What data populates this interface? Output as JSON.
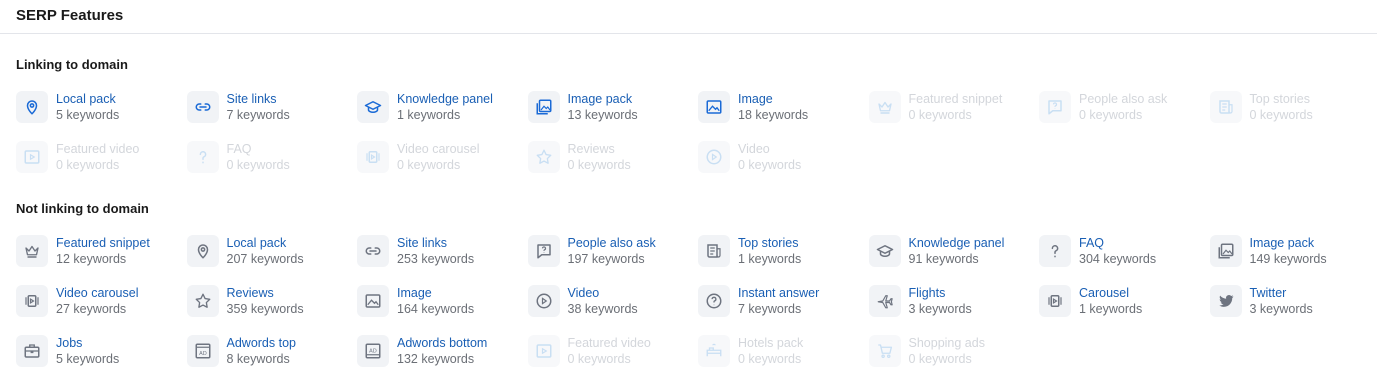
{
  "header": {
    "title": "SERP Features"
  },
  "sections": {
    "linking": {
      "title": "Linking to domain",
      "items": [
        {
          "label": "Local pack",
          "count": "5 keywords",
          "icon": "location-pin-icon",
          "state": "active-blue"
        },
        {
          "label": "Site links",
          "count": "7 keywords",
          "icon": "link-icon",
          "state": "active-blue"
        },
        {
          "label": "Knowledge panel",
          "count": "1 keywords",
          "icon": "graduation-cap-icon",
          "state": "active-blue"
        },
        {
          "label": "Image pack",
          "count": "13 keywords",
          "icon": "image-pack-icon",
          "state": "active-blue"
        },
        {
          "label": "Image",
          "count": "18 keywords",
          "icon": "image-icon",
          "state": "active-blue"
        },
        {
          "label": "Featured snippet",
          "count": "0 keywords",
          "icon": "crown-icon",
          "state": "disabled"
        },
        {
          "label": "People also ask",
          "count": "0 keywords",
          "icon": "question-bubble-icon",
          "state": "disabled"
        },
        {
          "label": "Top stories",
          "count": "0 keywords",
          "icon": "news-icon",
          "state": "disabled"
        },
        {
          "label": "Featured video",
          "count": "0 keywords",
          "icon": "video-frame-icon",
          "state": "disabled"
        },
        {
          "label": "FAQ",
          "count": "0 keywords",
          "icon": "question-mark-icon",
          "state": "disabled"
        },
        {
          "label": "Video carousel",
          "count": "0 keywords",
          "icon": "carousel-icon",
          "state": "disabled"
        },
        {
          "label": "Reviews",
          "count": "0 keywords",
          "icon": "star-icon",
          "state": "disabled"
        },
        {
          "label": "Video",
          "count": "0 keywords",
          "icon": "play-circle-icon",
          "state": "disabled"
        }
      ]
    },
    "not_linking": {
      "title": "Not linking to domain",
      "items": [
        {
          "label": "Featured snippet",
          "count": "12 keywords",
          "icon": "crown-icon",
          "state": "active-gray"
        },
        {
          "label": "Local pack",
          "count": "207 keywords",
          "icon": "location-pin-icon",
          "state": "active-gray"
        },
        {
          "label": "Site links",
          "count": "253 keywords",
          "icon": "link-icon",
          "state": "active-gray"
        },
        {
          "label": "People also ask",
          "count": "197 keywords",
          "icon": "question-bubble-icon",
          "state": "active-gray"
        },
        {
          "label": "Top stories",
          "count": "1 keywords",
          "icon": "news-icon",
          "state": "active-gray"
        },
        {
          "label": "Knowledge panel",
          "count": "91 keywords",
          "icon": "graduation-cap-icon",
          "state": "active-gray"
        },
        {
          "label": "FAQ",
          "count": "304 keywords",
          "icon": "question-mark-icon",
          "state": "active-gray"
        },
        {
          "label": "Image pack",
          "count": "149 keywords",
          "icon": "image-pack-icon",
          "state": "active-gray"
        },
        {
          "label": "Video carousel",
          "count": "27 keywords",
          "icon": "carousel-icon",
          "state": "active-gray"
        },
        {
          "label": "Reviews",
          "count": "359 keywords",
          "icon": "star-icon",
          "state": "active-gray"
        },
        {
          "label": "Image",
          "count": "164 keywords",
          "icon": "image-icon",
          "state": "active-gray"
        },
        {
          "label": "Video",
          "count": "38 keywords",
          "icon": "play-circle-icon",
          "state": "active-gray"
        },
        {
          "label": "Instant answer",
          "count": "7 keywords",
          "icon": "question-circle-icon",
          "state": "active-gray"
        },
        {
          "label": "Flights",
          "count": "3 keywords",
          "icon": "airplane-icon",
          "state": "active-gray"
        },
        {
          "label": "Carousel",
          "count": "1 keywords",
          "icon": "carousel-icon",
          "state": "active-gray"
        },
        {
          "label": "Twitter",
          "count": "3 keywords",
          "icon": "twitter-icon",
          "state": "active-gray"
        },
        {
          "label": "Jobs",
          "count": "5 keywords",
          "icon": "briefcase-icon",
          "state": "active-gray"
        },
        {
          "label": "Adwords top",
          "count": "8 keywords",
          "icon": "ad-top-icon",
          "state": "active-gray"
        },
        {
          "label": "Adwords bottom",
          "count": "132 keywords",
          "icon": "ad-bottom-icon",
          "state": "active-gray"
        },
        {
          "label": "Featured video",
          "count": "0 keywords",
          "icon": "video-frame-icon",
          "state": "disabled"
        },
        {
          "label": "Hotels pack",
          "count": "0 keywords",
          "icon": "hotel-icon",
          "state": "disabled"
        },
        {
          "label": "Shopping ads",
          "count": "0 keywords",
          "icon": "cart-icon",
          "state": "disabled"
        }
      ]
    }
  },
  "colors": {
    "link_blue": "#1a5fb4",
    "icon_blue": "#1a6ad6",
    "icon_gray": "#6e7480",
    "disabled": "#c9dff3"
  }
}
